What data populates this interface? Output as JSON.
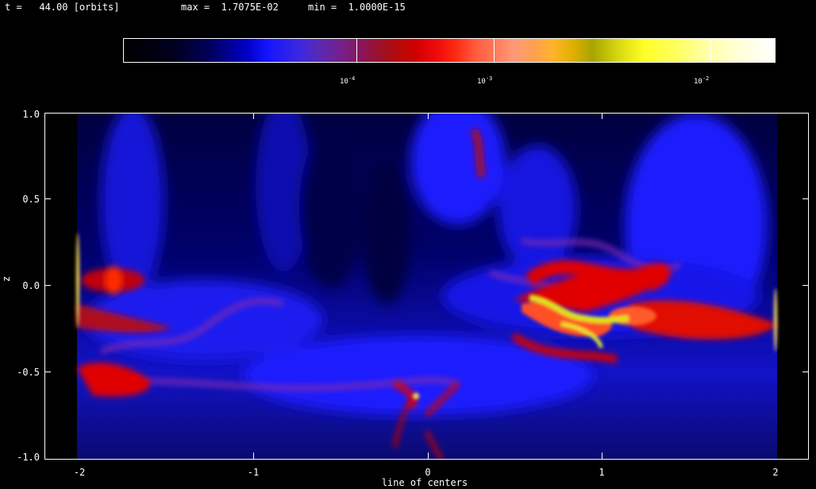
{
  "header": {
    "time": "t =   44.00 [orbits]",
    "max": "max =  1.7075E-02",
    "min": "min =  1.0000E-15"
  },
  "colorbar": {
    "labels": [
      {
        "base": "10",
        "exp": "-4"
      },
      {
        "base": "10",
        "exp": "-3"
      },
      {
        "base": "10",
        "exp": "-2"
      }
    ]
  },
  "axes": {
    "xlabel": "line of centers",
    "ylabel": "z",
    "xticks": [
      "-2",
      "-1",
      "0",
      "1",
      "2"
    ],
    "yticks": [
      "1.0",
      "0.5",
      "0.0",
      "-0.5",
      "-1.0"
    ]
  },
  "colors": {
    "background": "#000000",
    "field_low": "#00004a",
    "field_mid": "#1a1aff",
    "field_hot": "#e00000",
    "field_peak": "#ffff40"
  }
}
